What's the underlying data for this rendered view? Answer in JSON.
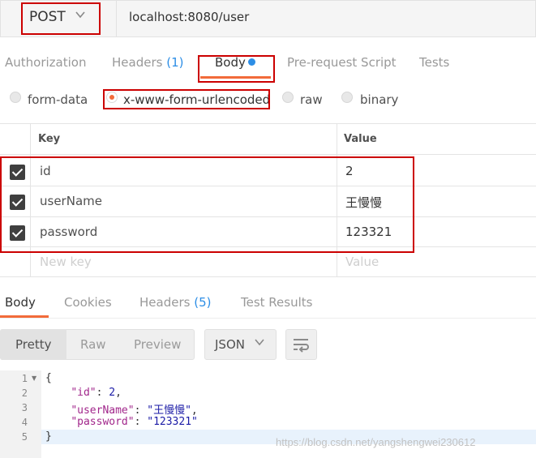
{
  "request": {
    "method": "POST",
    "url": "localhost:8080/user"
  },
  "request_tabs": {
    "authorization": "Authorization",
    "headers": "Headers",
    "headers_count": "(1)",
    "body": "Body",
    "prerequest": "Pre-request Script",
    "tests": "Tests"
  },
  "body_types": {
    "form_data": "form-data",
    "urlencoded": "x-www-form-urlencoded",
    "raw": "raw",
    "binary": "binary",
    "selected": "x-www-form-urlencoded"
  },
  "params": {
    "header_key": "Key",
    "header_value": "Value",
    "rows": [
      {
        "key": "id",
        "value": "2"
      },
      {
        "key": "userName",
        "value": "王慢慢"
      },
      {
        "key": "password",
        "value": "123321"
      }
    ],
    "placeholder_key": "New key",
    "placeholder_value": "Value"
  },
  "response_tabs": {
    "body": "Body",
    "cookies": "Cookies",
    "headers": "Headers",
    "headers_count": "(5)",
    "test_results": "Test Results"
  },
  "response_toolbar": {
    "pretty": "Pretty",
    "raw": "Raw",
    "preview": "Preview",
    "format": "JSON"
  },
  "response_code": {
    "line_numbers": [
      "1",
      "2",
      "3",
      "4",
      "5"
    ],
    "open_brace": "{",
    "close_brace": "}",
    "id_key": "\"id\"",
    "id_value": "2",
    "username_key": "\"userName\"",
    "username_value": "\"王慢慢\"",
    "password_key": "\"password\"",
    "password_value": "\"123321\""
  },
  "watermark": "https://blog.csdn.net/yangshengwei230612",
  "colors": {
    "accent_orange": "#f26b3a",
    "accent_blue": "#2d8ee6",
    "annotation_red": "#cc0000"
  }
}
